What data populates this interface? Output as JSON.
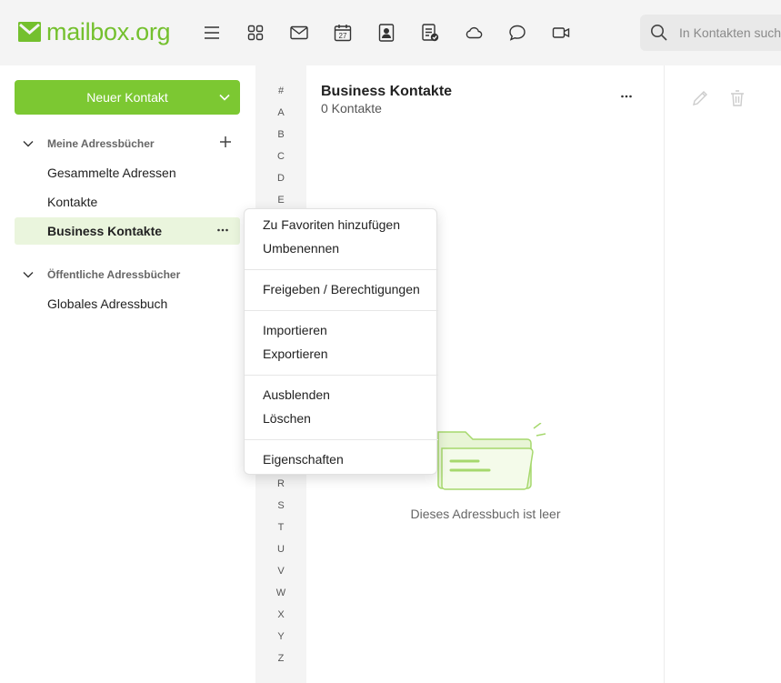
{
  "brand": {
    "name": "mailbox.org",
    "color": "#74c02e"
  },
  "topbar": {
    "icons": [
      "menu-icon",
      "apps-grid-icon",
      "mail-icon",
      "calendar-icon",
      "contacts-icon",
      "tasks-icon",
      "cloud-icon",
      "chat-icon",
      "video-icon"
    ],
    "calendar_day": "27",
    "search_placeholder": "In Kontakten suchen"
  },
  "sidebar": {
    "new_contact_label": "Neuer Kontakt",
    "my_books_label": "Meine Adressbücher",
    "my_books": [
      "Gesammelte Adressen",
      "Kontakte",
      "Business Kontakte"
    ],
    "active_book": "Business Kontakte",
    "public_books_label": "Öffentliche Adressbücher",
    "public_books": [
      "Globales Adressbuch"
    ]
  },
  "letters": [
    "#",
    "A",
    "B",
    "C",
    "D",
    "E",
    "R",
    "S",
    "T",
    "U",
    "V",
    "W",
    "X",
    "Y",
    "Z"
  ],
  "list": {
    "title": "Business Kontakte",
    "count": "0 Kontakte",
    "empty_text": "Dieses Adressbuch ist leer"
  },
  "context_menu": {
    "items": [
      "Zu Favoriten hinzufügen",
      "Umbenennen",
      "Freigeben / Berechtigungen",
      "Importieren",
      "Exportieren",
      "Ausblenden",
      "Löschen",
      "Eigenschaften"
    ]
  },
  "colors": {
    "accent": "#7cc832",
    "active_bg": "#eaf5dd",
    "panel_bg": "#f4f4f4"
  }
}
